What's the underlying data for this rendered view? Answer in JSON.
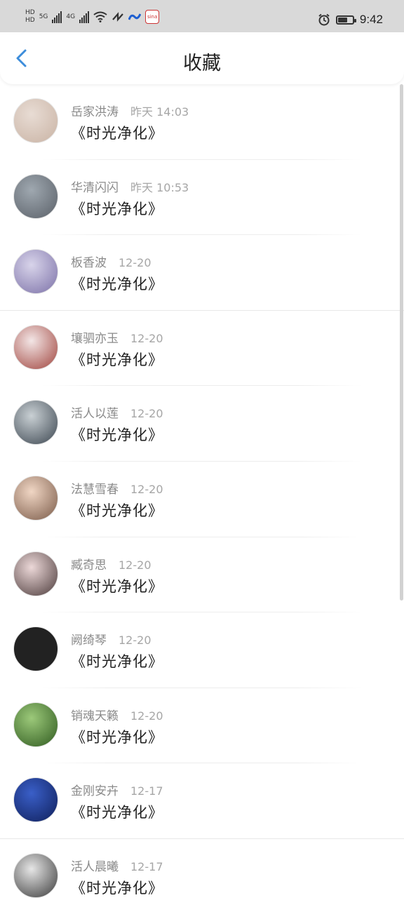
{
  "status_bar": {
    "time": "9:42",
    "signal_left_label": "5G",
    "signal_right_label": "4G",
    "hd1": "HD",
    "hd2": "HD",
    "app_badge": "sina"
  },
  "header": {
    "title": "收藏"
  },
  "items": [
    {
      "name": "岳家洪涛",
      "date": "昨天 14:03",
      "work": "《时光净化》",
      "avatar_colors": [
        "#e8dcd4",
        "#c9b3a4"
      ]
    },
    {
      "name": "华清闪闪",
      "date": "昨天 10:53",
      "work": "《时光净化》",
      "avatar_colors": [
        "#9fa8b0",
        "#5a6068"
      ]
    },
    {
      "name": "板香波",
      "date": "12-20",
      "work": "《时光净化》",
      "avatar_colors": [
        "#d8d4ea",
        "#7c71a8"
      ]
    },
    {
      "name": "壤驷亦玉",
      "date": "12-20",
      "work": "《时光净化》",
      "avatar_colors": [
        "#f3e6e6",
        "#a0443d"
      ]
    },
    {
      "name": "活人以莲",
      "date": "12-20",
      "work": "《时光净化》",
      "avatar_colors": [
        "#c9d0d4",
        "#3c4650"
      ]
    },
    {
      "name": "法慧雪春",
      "date": "12-20",
      "work": "《时光净化》",
      "avatar_colors": [
        "#f0d6c4",
        "#7a5a48"
      ]
    },
    {
      "name": "臧奇思",
      "date": "12-20",
      "work": "《时光净化》",
      "avatar_colors": [
        "#ecd8d8",
        "#4b3a3a"
      ]
    },
    {
      "name": "阙绮琴",
      "date": "12-20",
      "work": "《时光净化》",
      "avatar_colors": [
        "#222222",
        "#222222"
      ]
    },
    {
      "name": "销魂天籁",
      "date": "12-20",
      "work": "《时光净化》",
      "avatar_colors": [
        "#9cc97a",
        "#2f5a1f"
      ]
    },
    {
      "name": "金刚安卉",
      "date": "12-17",
      "work": "《时光净化》",
      "avatar_colors": [
        "#3a5fc8",
        "#0f1f5a"
      ]
    },
    {
      "name": "活人晨曦",
      "date": "12-17",
      "work": "《时光净化》",
      "avatar_colors": [
        "#e6e6e6",
        "#3a3a3a"
      ]
    }
  ]
}
